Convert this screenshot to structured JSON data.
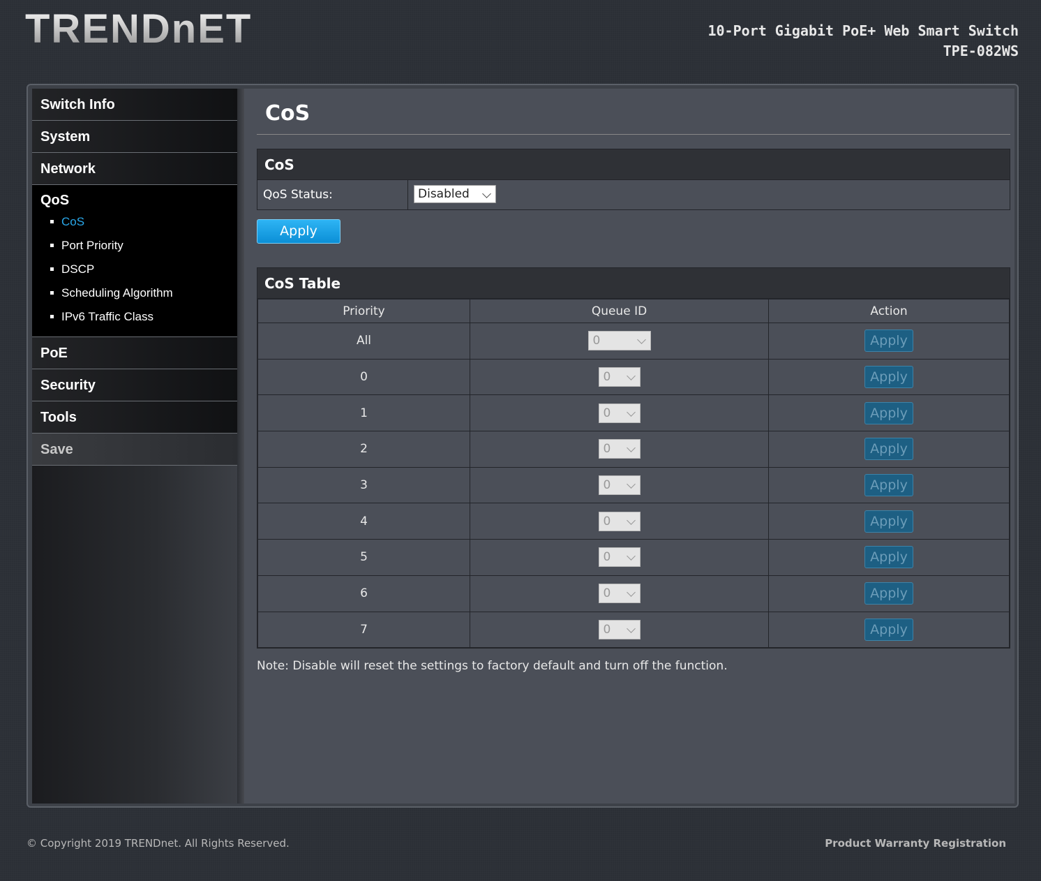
{
  "header": {
    "logo_text": "TRENDnET",
    "product_name": "10-Port Gigabit PoE+ Web Smart Switch",
    "model": "TPE-082WS"
  },
  "sidebar": {
    "items_top": [
      {
        "label": "Switch Info"
      },
      {
        "label": "System"
      },
      {
        "label": "Network"
      }
    ],
    "qos": {
      "label": "QoS",
      "subitems": [
        {
          "label": "CoS",
          "active": true
        },
        {
          "label": "Port Priority"
        },
        {
          "label": "DSCP"
        },
        {
          "label": "Scheduling Algorithm"
        },
        {
          "label": "IPv6 Traffic Class"
        }
      ]
    },
    "items_bottom": [
      {
        "label": "PoE"
      },
      {
        "label": "Security"
      },
      {
        "label": "Tools"
      },
      {
        "label": "Save"
      }
    ]
  },
  "main": {
    "page_title": "CoS",
    "cos_box": {
      "title": "CoS",
      "status_label": "QoS Status:",
      "status_value": "Disabled",
      "apply_label": "Apply"
    },
    "table_box": {
      "title": "CoS Table",
      "columns": [
        "Priority",
        "Queue ID",
        "Action"
      ],
      "rows": [
        {
          "priority": "All",
          "queue": "0",
          "action": "Apply"
        },
        {
          "priority": "0",
          "queue": "0",
          "action": "Apply"
        },
        {
          "priority": "1",
          "queue": "0",
          "action": "Apply"
        },
        {
          "priority": "2",
          "queue": "0",
          "action": "Apply"
        },
        {
          "priority": "3",
          "queue": "0",
          "action": "Apply"
        },
        {
          "priority": "4",
          "queue": "0",
          "action": "Apply"
        },
        {
          "priority": "5",
          "queue": "0",
          "action": "Apply"
        },
        {
          "priority": "6",
          "queue": "0",
          "action": "Apply"
        },
        {
          "priority": "7",
          "queue": "0",
          "action": "Apply"
        }
      ]
    },
    "note": "Note: Disable will reset the settings to factory default and turn off the function."
  },
  "footer": {
    "copyright": "© Copyright 2019 TRENDnet. All Rights Reserved.",
    "warranty_link": "Product Warranty Registration"
  },
  "colors": {
    "accent": "#2aa8ea",
    "apply_button": "#0b8fd6",
    "panel": "#4b4f58"
  }
}
